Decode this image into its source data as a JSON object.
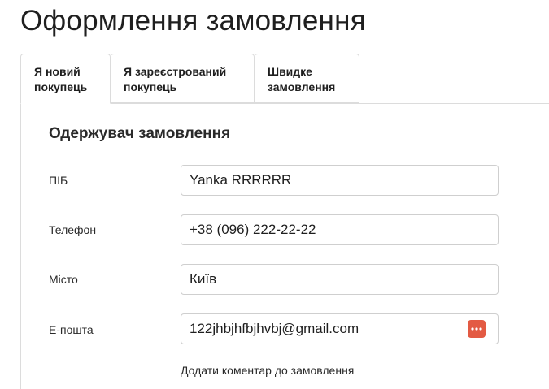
{
  "page": {
    "title": "Оформлення замовлення"
  },
  "tabs": [
    {
      "label": "Я новий\nпокупець",
      "active": true
    },
    {
      "label": "Я зареєстрований\nпокупець",
      "active": false
    },
    {
      "label": "Швидке\nзамовлення",
      "active": false
    }
  ],
  "form": {
    "section_title": "Одержувач замовлення",
    "fields": [
      {
        "label": "ПІБ",
        "value": "Yanka RRRRRR",
        "placeholder": ""
      },
      {
        "label": "Телефон",
        "value": "+38 (096) 222-22-22",
        "placeholder": ""
      },
      {
        "label": "Місто",
        "value": "Київ",
        "placeholder": ""
      },
      {
        "label": "E-пошта",
        "value": "122jhbjhfbjhvbj@gmail.com",
        "placeholder": ""
      }
    ],
    "autofill_icon": "password-manager-icon",
    "autofill_icon_color": "#e35a43",
    "comment_link": "Додати коментар до замовлення"
  }
}
